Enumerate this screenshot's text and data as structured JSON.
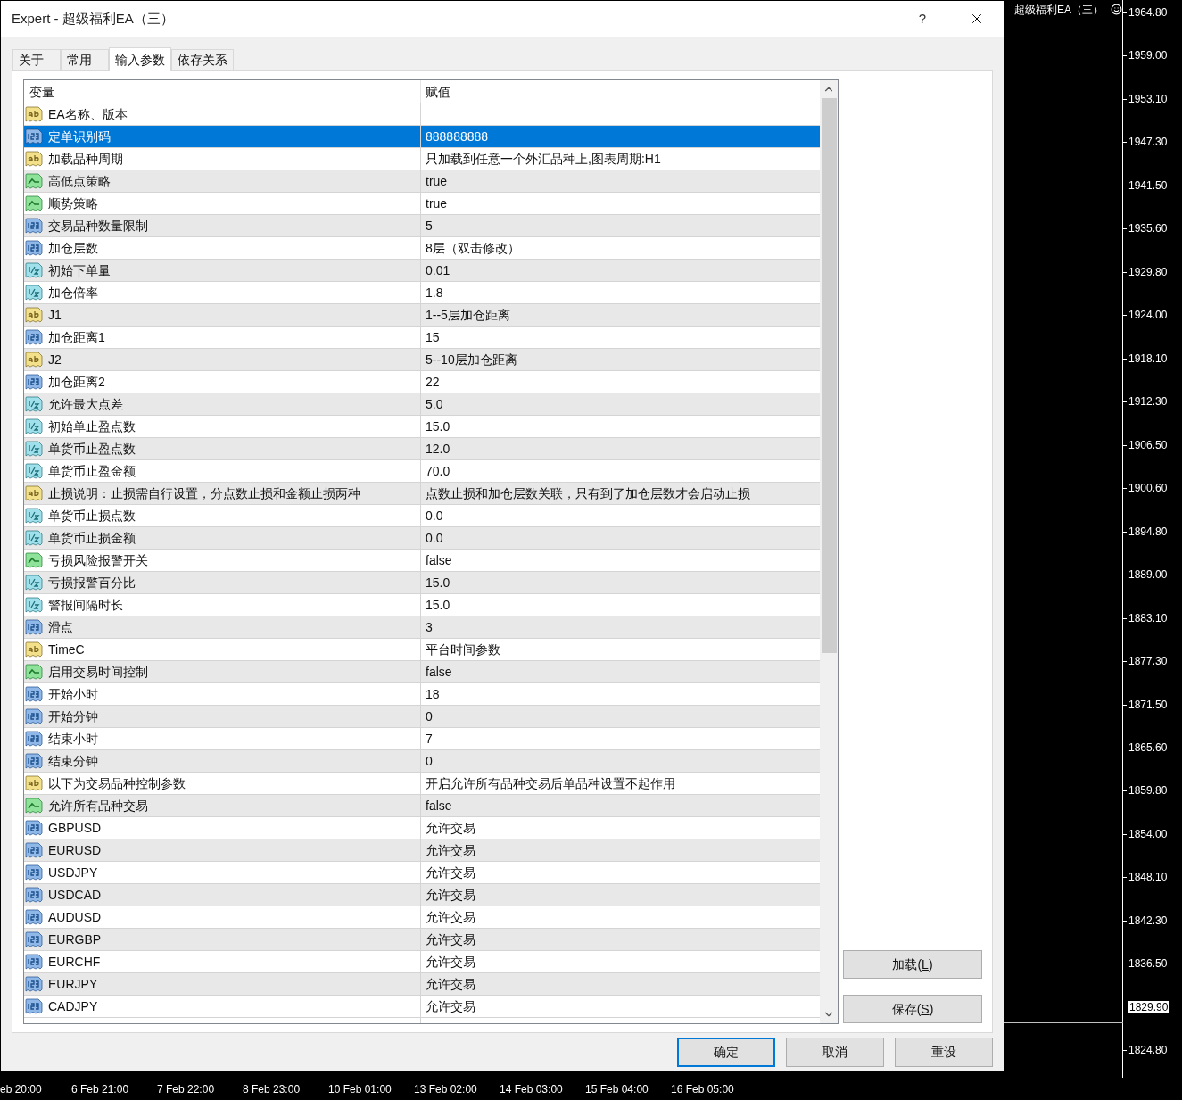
{
  "window": {
    "title": "Expert - 超级福利EA（三）",
    "help": "?"
  },
  "tabs": [
    {
      "label": "关于",
      "selected": false
    },
    {
      "label": "常用",
      "selected": false
    },
    {
      "label": "输入参数",
      "selected": true
    },
    {
      "label": "依存关系",
      "selected": false
    }
  ],
  "table": {
    "columns": [
      "变量",
      "赋值"
    ],
    "rows": [
      {
        "kind": "string",
        "name": "EA名称、版本",
        "selected": false
      },
      {
        "kind": "int",
        "name": "定单识别码",
        "value": "888888888",
        "selected": true
      },
      {
        "kind": "string",
        "name": "加载品种周期",
        "value": "只加载到任意一个外汇品种上,图表周期:H1",
        "selected": false
      },
      {
        "kind": "bool",
        "name": "高低点策略",
        "value": "true",
        "selected": false
      },
      {
        "kind": "bool",
        "name": "顺势策略",
        "value": "true",
        "selected": false
      },
      {
        "kind": "int",
        "name": "交易品种数量限制",
        "value": "5",
        "selected": false
      },
      {
        "kind": "int",
        "name": "加仓层数",
        "value": "8层（双击修改）",
        "selected": false
      },
      {
        "kind": "double",
        "name": "初始下单量",
        "value": "0.01",
        "selected": false
      },
      {
        "kind": "double",
        "name": "加仓倍率",
        "value": "1.8",
        "selected": false
      },
      {
        "kind": "string",
        "name": "J1",
        "value": "1--5层加仓距离",
        "selected": false
      },
      {
        "kind": "int",
        "name": "加仓距离1",
        "value": "15",
        "selected": false
      },
      {
        "kind": "string",
        "name": "J2",
        "value": "5--10层加仓距离",
        "selected": false
      },
      {
        "kind": "int",
        "name": "加仓距离2",
        "value": "22",
        "selected": false
      },
      {
        "kind": "double",
        "name": "允许最大点差",
        "value": "5.0",
        "selected": false
      },
      {
        "kind": "double",
        "name": "初始单止盈点数",
        "value": "15.0",
        "selected": false
      },
      {
        "kind": "double",
        "name": "单货币止盈点数",
        "value": "12.0",
        "selected": false
      },
      {
        "kind": "double",
        "name": "单货币止盈金额",
        "value": "70.0",
        "selected": false
      },
      {
        "kind": "string",
        "name": "止损说明：止损需自行设置，分点数止损和金额止损两种",
        "value": "点数止损和加仓层数关联，只有到了加仓层数才会启动止损",
        "selected": false
      },
      {
        "kind": "double",
        "name": "单货币止损点数",
        "value": "0.0",
        "selected": false
      },
      {
        "kind": "double",
        "name": "单货币止损金额",
        "value": "0.0",
        "selected": false
      },
      {
        "kind": "bool",
        "name": "亏损风险报警开关",
        "value": "false",
        "selected": false
      },
      {
        "kind": "double",
        "name": "亏损报警百分比",
        "value": "15.0",
        "selected": false
      },
      {
        "kind": "double",
        "name": "警报间隔时长",
        "value": "15.0",
        "selected": false
      },
      {
        "kind": "int",
        "name": "滑点",
        "value": "3",
        "selected": false
      },
      {
        "kind": "string",
        "name": "TimeC",
        "value": "平台时间参数",
        "selected": false
      },
      {
        "kind": "bool",
        "name": "启用交易时间控制",
        "value": "false",
        "selected": false
      },
      {
        "kind": "int",
        "name": "开始小时",
        "value": "18",
        "selected": false
      },
      {
        "kind": "int",
        "name": "开始分钟",
        "value": "0",
        "selected": false
      },
      {
        "kind": "int",
        "name": "结束小时",
        "value": "7",
        "selected": false
      },
      {
        "kind": "int",
        "name": "结束分钟",
        "value": "0",
        "selected": false
      },
      {
        "kind": "string",
        "name": "以下为交易品种控制参数",
        "value": "开启允许所有品种交易后单品种设置不起作用",
        "selected": false
      },
      {
        "kind": "bool",
        "name": "允许所有品种交易",
        "value": "false",
        "selected": false
      },
      {
        "kind": "int",
        "name": "GBPUSD",
        "value": "允许交易",
        "selected": false
      },
      {
        "kind": "int",
        "name": "EURUSD",
        "value": "允许交易",
        "selected": false
      },
      {
        "kind": "int",
        "name": "USDJPY",
        "value": "允许交易",
        "selected": false
      },
      {
        "kind": "int",
        "name": "USDCAD",
        "value": "允许交易",
        "selected": false
      },
      {
        "kind": "int",
        "name": "AUDUSD",
        "value": "允许交易",
        "selected": false
      },
      {
        "kind": "int",
        "name": "EURGBP",
        "value": "允许交易",
        "selected": false
      },
      {
        "kind": "int",
        "name": "EURCHF",
        "value": "允许交易",
        "selected": false
      },
      {
        "kind": "int",
        "name": "EURJPY",
        "value": "允许交易",
        "selected": false
      },
      {
        "kind": "int",
        "name": "CADJPY",
        "value": "允许交易",
        "selected": false
      }
    ]
  },
  "side_buttons": [
    "加载(L)",
    "保存(S)"
  ],
  "dialog_buttons": [
    {
      "label": "确定",
      "default": true
    },
    {
      "label": "取消",
      "default": false
    },
    {
      "label": "重设",
      "default": false
    }
  ],
  "chart": {
    "title": "超级福利EA（三）",
    "price_axis": [
      "1964.80",
      "1959.00",
      "1953.10",
      "1947.30",
      "1941.50",
      "1935.60",
      "1929.80",
      "1924.00",
      "1918.10",
      "1912.30",
      "1906.50",
      "1900.60",
      "1894.80",
      "1889.00",
      "1883.10",
      "1877.30",
      "1871.50",
      "1865.60",
      "1859.80",
      "1854.00",
      "1848.10",
      "1842.30",
      "1836.50"
    ],
    "current_price": "1829.90",
    "last_price": "1824.80",
    "time_axis": [
      "eb 20:00",
      "6 Feb 21:00",
      "7 Feb 22:00",
      "8 Feb 23:00",
      "10 Feb 01:00",
      "13 Feb 02:00",
      "14 Feb 03:00",
      "15 Feb 04:00",
      "16 Feb 05:00"
    ]
  }
}
